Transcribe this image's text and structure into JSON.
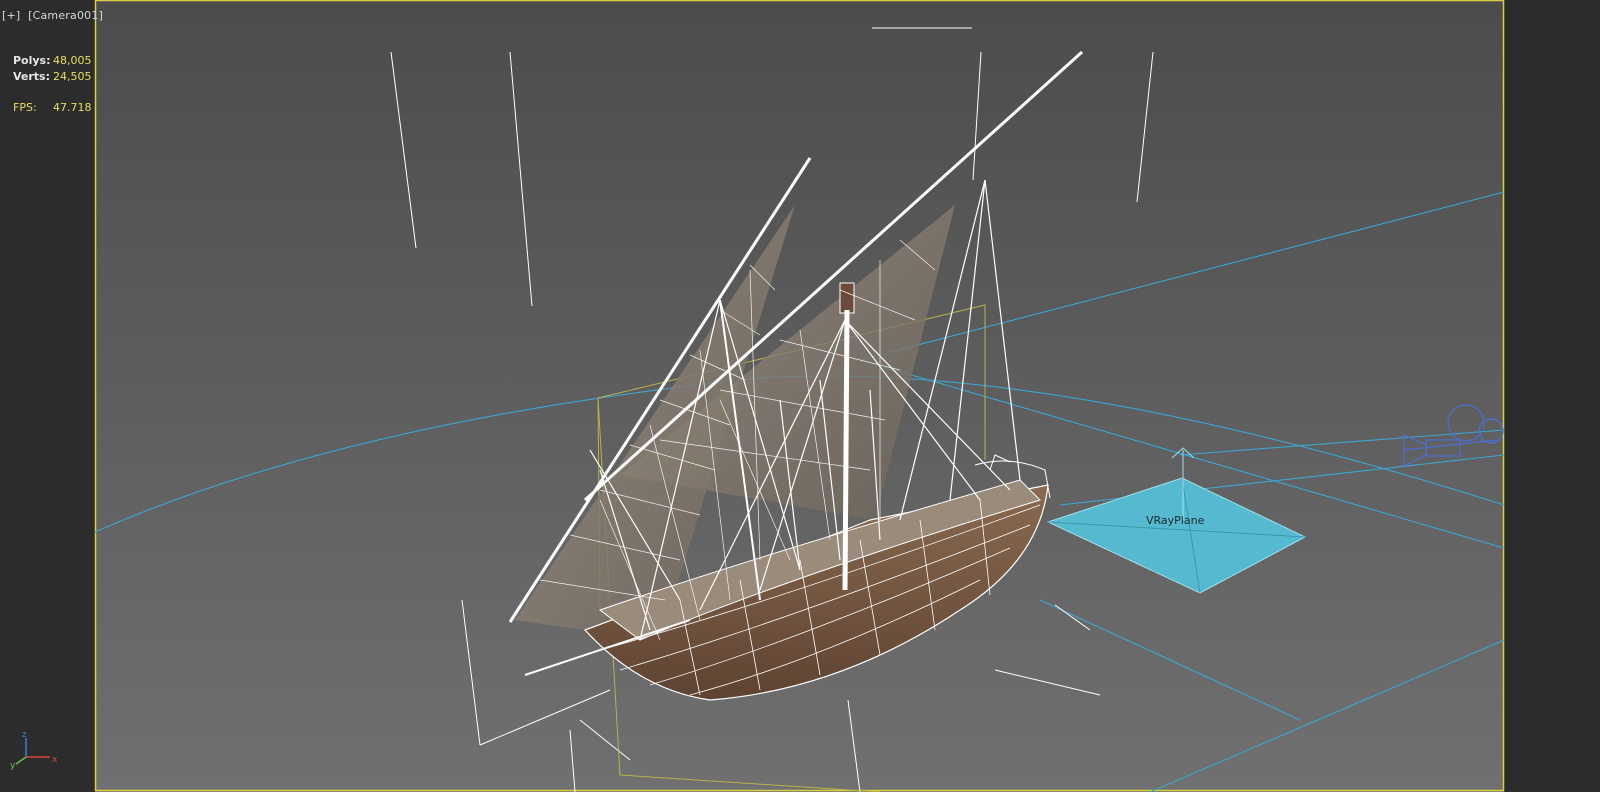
{
  "viewport": {
    "menu_label": "[+]",
    "camera_label": "[Camera001]"
  },
  "stats": {
    "polys_label": "Polys:",
    "polys_value": "48,005",
    "verts_label": "Verts:",
    "verts_value": "24,505",
    "fps_label": "FPS:",
    "fps_value": "47.718"
  },
  "scene": {
    "vray_plane_label": "VRayPlane",
    "colors": {
      "background_top": "#4e4e4e",
      "background_bottom": "#6e6e6e",
      "frame": "#d9cf3f",
      "helper_lines": "#3ba6d1",
      "vray_plane_fill": "#55b9cf",
      "wireframe": "#ffffff",
      "sail": "#8a7f72",
      "hull": "#7b5a42"
    },
    "axis_icons": [
      "axis-x-icon",
      "axis-y-icon",
      "axis-z-icon"
    ],
    "camera_icon": "camera-icon"
  }
}
